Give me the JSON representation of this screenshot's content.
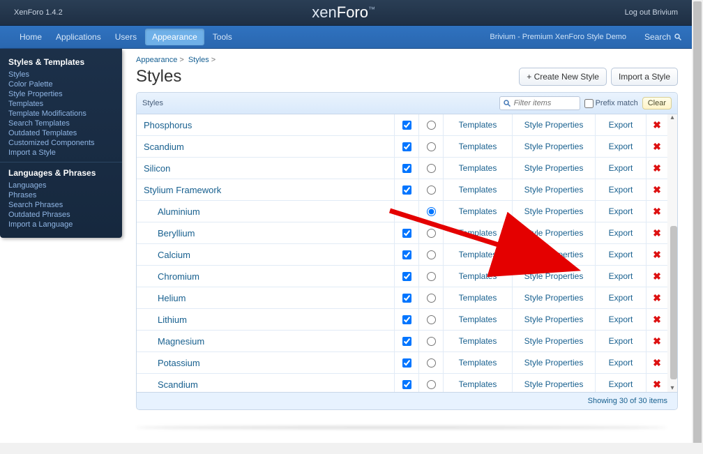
{
  "topbar": {
    "version": "XenForo 1.4.2",
    "brand_main": "xen",
    "brand_accent": "Foro",
    "logout": "Log out Brivium"
  },
  "nav": {
    "items": [
      {
        "label": "Home"
      },
      {
        "label": "Applications"
      },
      {
        "label": "Users"
      },
      {
        "label": "Appearance",
        "active": true
      },
      {
        "label": "Tools"
      }
    ],
    "demo": "Brivium - Premium XenForo Style Demo",
    "search": "Search"
  },
  "sidebar": {
    "group1_title": "Styles & Templates",
    "group1": [
      "Styles",
      "Color Palette",
      "Style Properties",
      "Templates",
      "Template Modifications",
      "Search Templates",
      "Outdated Templates",
      "Customized Components",
      "Import a Style"
    ],
    "group2_title": "Languages & Phrases",
    "group2": [
      "Languages",
      "Phrases",
      "Search Phrases",
      "Outdated Phrases",
      "Import a Language"
    ]
  },
  "breadcrumb": {
    "a": "Appearance",
    "b": "Styles"
  },
  "page_title": "Styles",
  "buttons": {
    "create": "+ Create New Style",
    "import": "Import a Style"
  },
  "panel_header": {
    "title": "Styles",
    "filter_placeholder": "Filter items",
    "prefix_match": "Prefix match",
    "clear": "Clear"
  },
  "col_labels": {
    "templates": "Templates",
    "style_properties": "Style Properties",
    "export": "Export"
  },
  "rows": [
    {
      "name": "Phosphorus",
      "indent": false,
      "checked": true,
      "selected": false
    },
    {
      "name": "Scandium",
      "indent": false,
      "checked": true,
      "selected": false
    },
    {
      "name": "Silicon",
      "indent": false,
      "checked": true,
      "selected": false
    },
    {
      "name": "Stylium Framework",
      "indent": false,
      "checked": true,
      "selected": false
    },
    {
      "name": "Aluminium",
      "indent": true,
      "checked": false,
      "checked_hidden": true,
      "selected": true
    },
    {
      "name": "Beryllium",
      "indent": true,
      "checked": true,
      "selected": false
    },
    {
      "name": "Calcium",
      "indent": true,
      "checked": true,
      "selected": false
    },
    {
      "name": "Chromium",
      "indent": true,
      "checked": true,
      "selected": false
    },
    {
      "name": "Helium",
      "indent": true,
      "checked": true,
      "selected": false
    },
    {
      "name": "Lithium",
      "indent": true,
      "checked": true,
      "selected": false
    },
    {
      "name": "Magnesium",
      "indent": true,
      "checked": true,
      "selected": false
    },
    {
      "name": "Potassium",
      "indent": true,
      "checked": true,
      "selected": false
    },
    {
      "name": "Scandium",
      "indent": true,
      "checked": true,
      "selected": false
    }
  ],
  "footer": "Showing 30 of 30 items"
}
